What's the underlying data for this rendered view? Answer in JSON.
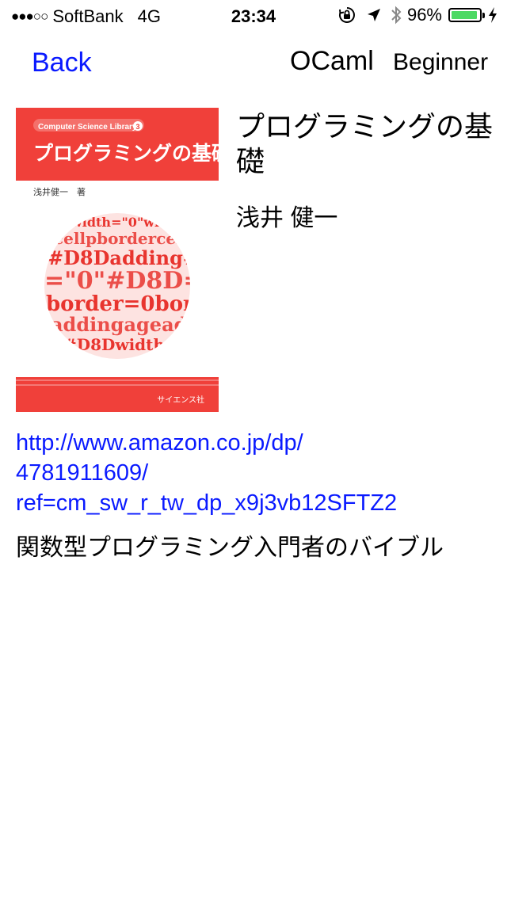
{
  "status_bar": {
    "signal_dots": "●●●○○",
    "carrier": "SoftBank",
    "network": "4G",
    "time": "23:34",
    "battery_percent": "96%",
    "battery_level": 0.96,
    "battery_color": "#4cd964"
  },
  "nav": {
    "back_label": "Back",
    "title": "OCaml",
    "subtitle": "Beginner"
  },
  "book": {
    "title": "プログラミングの基礎",
    "author": "浅井 健一",
    "cover": {
      "series": "Computer Science Library",
      "series_number": "3",
      "title": "プログラミングの基礎",
      "author_line": "浅井健一　著",
      "publisher": "サイエンス社",
      "words": [
        "width",
        "cellp",
        "#D8D",
        "=\"0\"",
        "border",
        "adding",
        "#D8D",
        "=0",
        "age"
      ],
      "accent_color": "#f0403a"
    },
    "link_lines": [
      "http://www.amazon.co.jp/dp/",
      "4781911609/",
      "ref=cm_sw_r_tw_dp_x9j3vb12SFTZ2"
    ],
    "description": "関数型プログラミング入門者のバイブル"
  },
  "colors": {
    "link": "#0a1aff",
    "text": "#000000",
    "background": "#ffffff"
  }
}
